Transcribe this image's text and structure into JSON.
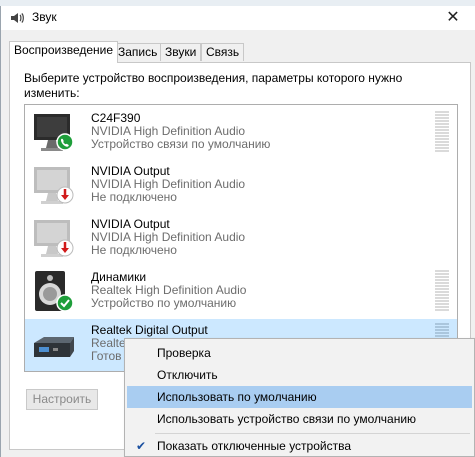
{
  "window": {
    "title": "Звук",
    "close_glyph": "✕"
  },
  "tabs": [
    {
      "label": "Воспроизведение",
      "active": true
    },
    {
      "label": "Запись",
      "active": false
    },
    {
      "label": "Звуки",
      "active": false
    },
    {
      "label": "Связь",
      "active": false
    }
  ],
  "instructions": "Выберите устройство воспроизведения, параметры которого нужно изменить:",
  "devices": [
    {
      "name": "C24F390",
      "driver": "NVIDIA High Definition Audio",
      "status": "Устройство связи по умолчанию",
      "icon": "monitor-icon",
      "badge": "phone-badge-icon"
    },
    {
      "name": "NVIDIA Output",
      "driver": "NVIDIA High Definition Audio",
      "status": "Не подключено",
      "icon": "monitor-icon",
      "badge": "disconnected-badge-icon"
    },
    {
      "name": "NVIDIA Output",
      "driver": "NVIDIA High Definition Audio",
      "status": "Не подключено",
      "icon": "monitor-icon",
      "badge": "disconnected-badge-icon"
    },
    {
      "name": "Динамики",
      "driver": "Realtek High Definition Audio",
      "status": "Устройство по умолчанию",
      "icon": "speaker-icon",
      "badge": "default-check-badge-icon"
    },
    {
      "name": "Realtek Digital Output",
      "driver": "Realtek High Definition Audio",
      "status": "Готов",
      "icon": "digital-output-icon",
      "badge": ""
    }
  ],
  "configure_label": "Настроить",
  "context_menu": {
    "items": [
      {
        "label": "Проверка",
        "highlighted": false,
        "checked": false
      },
      {
        "label": "Отключить",
        "highlighted": false,
        "checked": false
      },
      {
        "label": "Использовать по умолчанию",
        "highlighted": true,
        "checked": false
      },
      {
        "label": "Использовать устройство связи по умолчанию",
        "highlighted": false,
        "checked": false
      },
      {
        "label": "Показать отключенные устройства",
        "highlighted": false,
        "checked": true
      }
    ],
    "check_glyph": "✔"
  },
  "colors": {
    "selection": "#cce8ff",
    "menu_highlight": "#a9cdf1",
    "check_green": "#1e9e3a",
    "disconnected_red": "#d11a1a"
  }
}
